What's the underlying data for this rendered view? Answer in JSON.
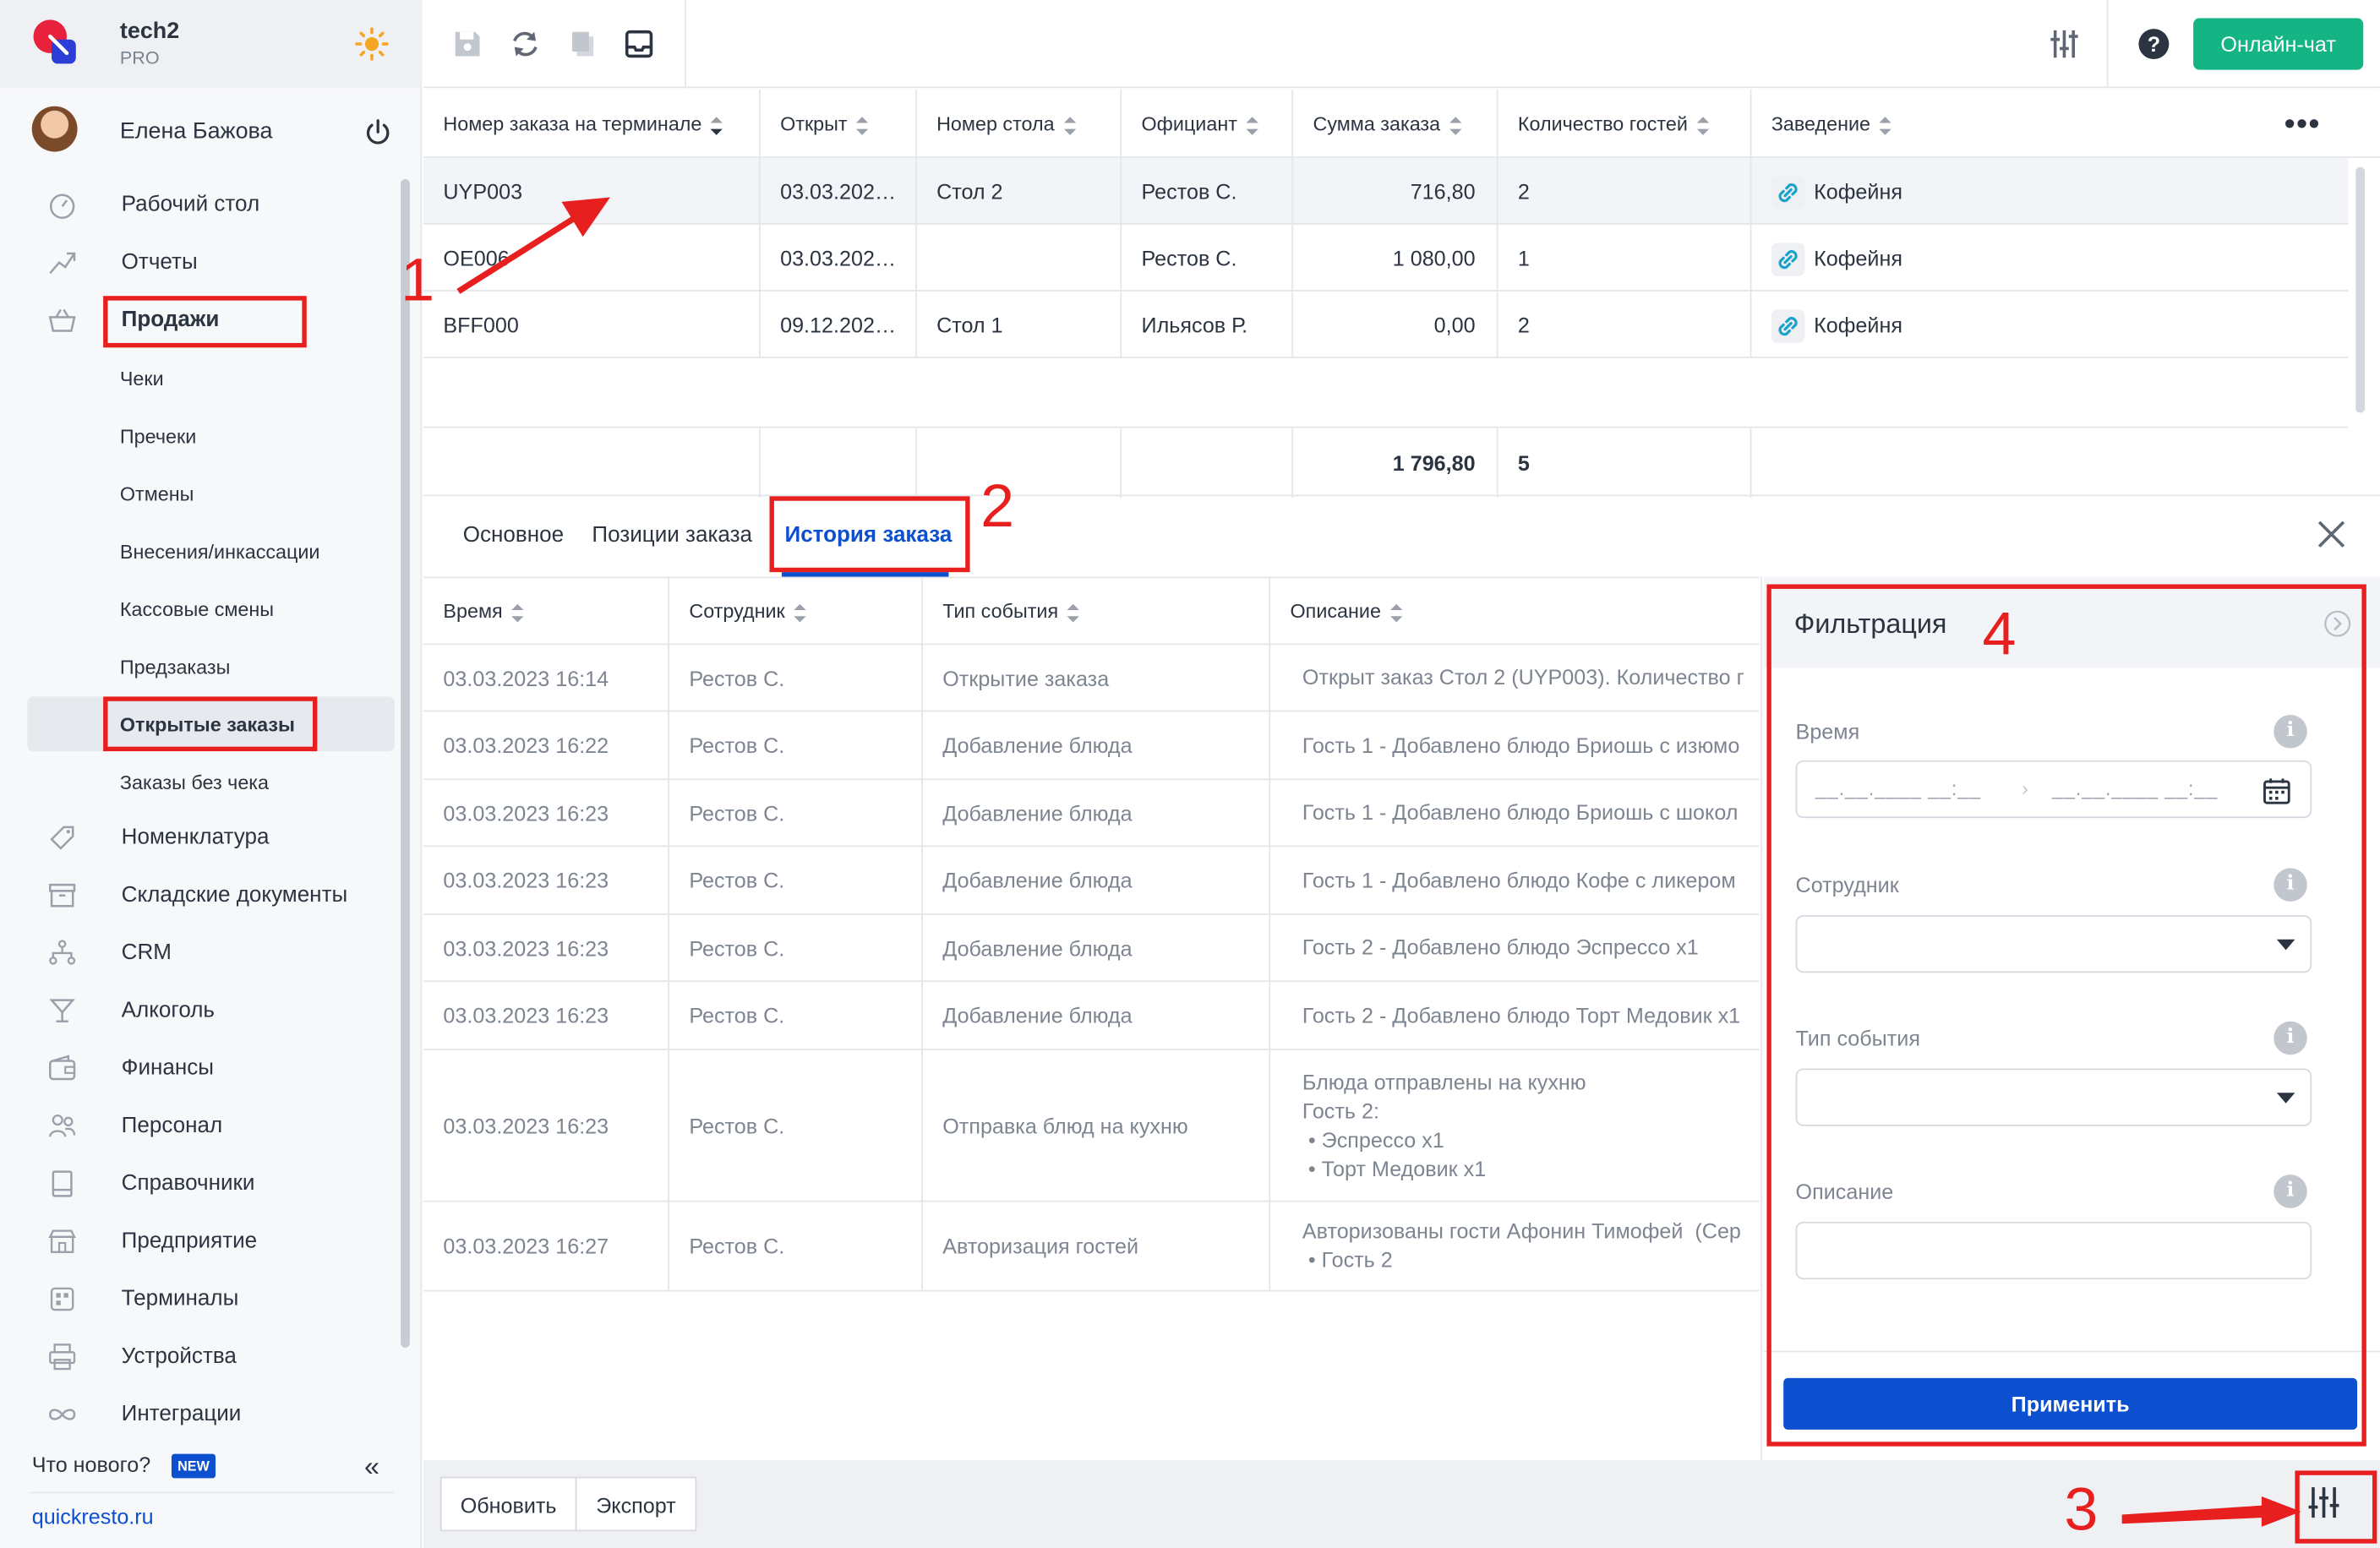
{
  "brand": {
    "name": "tech2",
    "plan": "PRO"
  },
  "user": {
    "name": "Елена Бажова"
  },
  "sidebar": {
    "main_items": [
      {
        "label": "Рабочий стол",
        "icon": "dashboard-icon"
      },
      {
        "label": "Отчеты",
        "icon": "reports-icon"
      },
      {
        "label": "Продажи",
        "icon": "basket-icon"
      }
    ],
    "sales_sub_items": [
      "Чеки",
      "Пречеки",
      "Отмены",
      "Внесения/инкассации",
      "Кассовые смены",
      "Предзаказы",
      "Открытые заказы",
      "Заказы без чека"
    ],
    "active_sub_item": "Открытые заказы",
    "other_items": [
      {
        "label": "Номенклатура",
        "icon": "tag-icon"
      },
      {
        "label": "Складские документы",
        "icon": "archive-icon"
      },
      {
        "label": "CRM",
        "icon": "crm-icon"
      },
      {
        "label": "Алкоголь",
        "icon": "glass-icon"
      },
      {
        "label": "Финансы",
        "icon": "wallet-icon"
      },
      {
        "label": "Персонал",
        "icon": "people-icon"
      },
      {
        "label": "Справочники",
        "icon": "book-icon"
      },
      {
        "label": "Предприятие",
        "icon": "store-icon"
      },
      {
        "label": "Терминалы",
        "icon": "terminal-icon"
      },
      {
        "label": "Устройства",
        "icon": "printer-icon"
      },
      {
        "label": "Интеграции",
        "icon": "infinity-icon"
      }
    ],
    "whats_new": "Что нового?",
    "new_badge": "NEW",
    "site_link": "quickresto.ru"
  },
  "toolbar": {
    "icons": [
      "save-icon",
      "refresh-icon",
      "copy-icon",
      "inbox-icon"
    ],
    "online_chat": "Онлайн-чат"
  },
  "orders": {
    "columns": [
      "Номер заказа на терминале",
      "Открыт",
      "Номер стола",
      "Официант",
      "Сумма заказа",
      "Количество гостей",
      "Заведение"
    ],
    "rows": [
      {
        "number": "UYP003",
        "opened": "03.03.202…",
        "table": "Стол 2",
        "waiter": "Рестов С.",
        "sum": "716,80",
        "guests": "2",
        "venue": "Кофейня"
      },
      {
        "number": "OE006",
        "opened": "03.03.202…",
        "table": "",
        "waiter": "Рестов С.",
        "sum": "1 080,00",
        "guests": "1",
        "venue": "Кофейня"
      },
      {
        "number": "BFF000",
        "opened": "09.12.202…",
        "table": "Стол 1",
        "waiter": "Ильясов Р.",
        "sum": "0,00",
        "guests": "2",
        "venue": "Кофейня"
      }
    ],
    "totals": {
      "sum": "1 796,80",
      "guests": "5"
    }
  },
  "tabs": {
    "items": [
      "Основное",
      "Позиции заказа",
      "История заказа"
    ],
    "active": "История заказа"
  },
  "history": {
    "columns": [
      "Время",
      "Сотрудник",
      "Тип события",
      "Описание"
    ],
    "rows": [
      {
        "time": "03.03.2023 16:14",
        "employee": "Рестов С.",
        "type": "Открытие заказа",
        "desc": [
          "Открыт заказ Стол 2 (UYP003). Количество г"
        ]
      },
      {
        "time": "03.03.2023 16:22",
        "employee": "Рестов С.",
        "type": "Добавление блюда",
        "desc": [
          "Гость 1 - Добавлено блюдо Бриошь с изюмо"
        ]
      },
      {
        "time": "03.03.2023 16:23",
        "employee": "Рестов С.",
        "type": "Добавление блюда",
        "desc": [
          "Гость 1 - Добавлено блюдо Бриошь с шокол"
        ]
      },
      {
        "time": "03.03.2023 16:23",
        "employee": "Рестов С.",
        "type": "Добавление блюда",
        "desc": [
          "Гость 1 - Добавлено блюдо Кофе с ликером"
        ]
      },
      {
        "time": "03.03.2023 16:23",
        "employee": "Рестов С.",
        "type": "Добавление блюда",
        "desc": [
          "Гость 2 - Добавлено блюдо Эспрессо x1"
        ]
      },
      {
        "time": "03.03.2023 16:23",
        "employee": "Рестов С.",
        "type": "Добавление блюда",
        "desc": [
          "Гость 2 - Добавлено блюдо Торт Медовик x1"
        ]
      },
      {
        "time": "03.03.2023 16:23",
        "employee": "Рестов С.",
        "type": "Отправка блюд на кухню",
        "desc": [
          "Блюда отправлены на кухню",
          "Гость 2:",
          " • Эспрессо x1",
          " • Торт Медовик x1"
        ]
      },
      {
        "time": "03.03.2023 16:27",
        "employee": "Рестов С.",
        "type": "Авторизация гостей",
        "desc": [
          "Авторизованы гости Афонин Тимофей  (Сер",
          " • Гость 2"
        ]
      }
    ]
  },
  "footer": {
    "refresh": "Обновить",
    "export": "Экспорт"
  },
  "filter": {
    "title": "Фильтрация",
    "time_label": "Время",
    "date_placeholder": "__.__.____ __:__",
    "employee_label": "Сотрудник",
    "event_type_label": "Тип события",
    "description_label": "Описание",
    "info": "i",
    "apply": "Применить"
  },
  "annotations": {
    "n1": "1",
    "n2": "2",
    "n3": "3",
    "n4": "4"
  },
  "colors": {
    "accent": "#0c4fcf",
    "chat": "#14b485",
    "annotation": "#e81f1f"
  }
}
